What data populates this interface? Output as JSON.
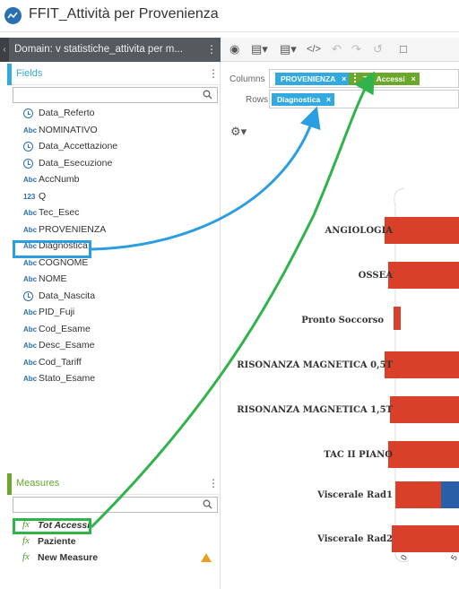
{
  "window": {
    "title": "FFIT_Attività per Provenienza"
  },
  "domain": {
    "label": "Domain: v statistiche_attivita per m..."
  },
  "fields": {
    "title": "Fields",
    "items": [
      {
        "name": "Data_Referto",
        "type": "date"
      },
      {
        "name": "NOMINATIVO",
        "type": "Abc"
      },
      {
        "name": "Data_Accettazione",
        "type": "date"
      },
      {
        "name": "Data_Esecuzione",
        "type": "date"
      },
      {
        "name": "AccNumb",
        "type": "Abc"
      },
      {
        "name": "Q",
        "type": "123"
      },
      {
        "name": "Tec_Esec",
        "type": "Abc"
      },
      {
        "name": "PROVENIENZA",
        "type": "Abc"
      },
      {
        "name": "Diagnostica",
        "type": "Abc"
      },
      {
        "name": "COGNOME",
        "type": "Abc"
      },
      {
        "name": "NOME",
        "type": "Abc"
      },
      {
        "name": "Data_Nascita",
        "type": "date"
      },
      {
        "name": "PID_Fuji",
        "type": "Abc"
      },
      {
        "name": "Cod_Esame",
        "type": "Abc"
      },
      {
        "name": "Desc_Esame",
        "type": "Abc"
      },
      {
        "name": "Cod_Tariff",
        "type": "Abc"
      },
      {
        "name": "Stato_Esame",
        "type": "Abc"
      }
    ]
  },
  "measures": {
    "title": "Measures",
    "items": [
      {
        "name": "Tot Accessi"
      },
      {
        "name": "Paziente"
      },
      {
        "name": "New Measure"
      }
    ]
  },
  "shelves": {
    "columns_label": "Columns",
    "rows_label": "Rows",
    "columns_pills": [
      "PROVENIENZA",
      "Tot Accessi"
    ],
    "rows_pills": [
      "Diagnostica"
    ]
  },
  "chart_data": {
    "type": "bar",
    "categories": [
      "ANGIOLOGIA",
      "OSSEA",
      "Pronto Soccorso",
      "RISONANZA MAGNETICA 0,5T",
      "RISONANZA MAGNETICA 1,5T",
      "TAC II PIANO",
      "Viscerale Rad1",
      "Viscerale Rad2"
    ],
    "x_ticks": [
      "0",
      "5"
    ],
    "colors": {
      "primary": "#d8402a",
      "secondary": "#2a5fa8"
    },
    "bar_starts": [
      0.06,
      0.04,
      0.0,
      0.06,
      0.03,
      0.04,
      0.0,
      0.02
    ]
  },
  "colors": {
    "accent_blue": "#33aadf",
    "accent_green": "#6aa72a",
    "arrow_blue": "#2a9ee0",
    "arrow_green": "#2fb34a"
  }
}
